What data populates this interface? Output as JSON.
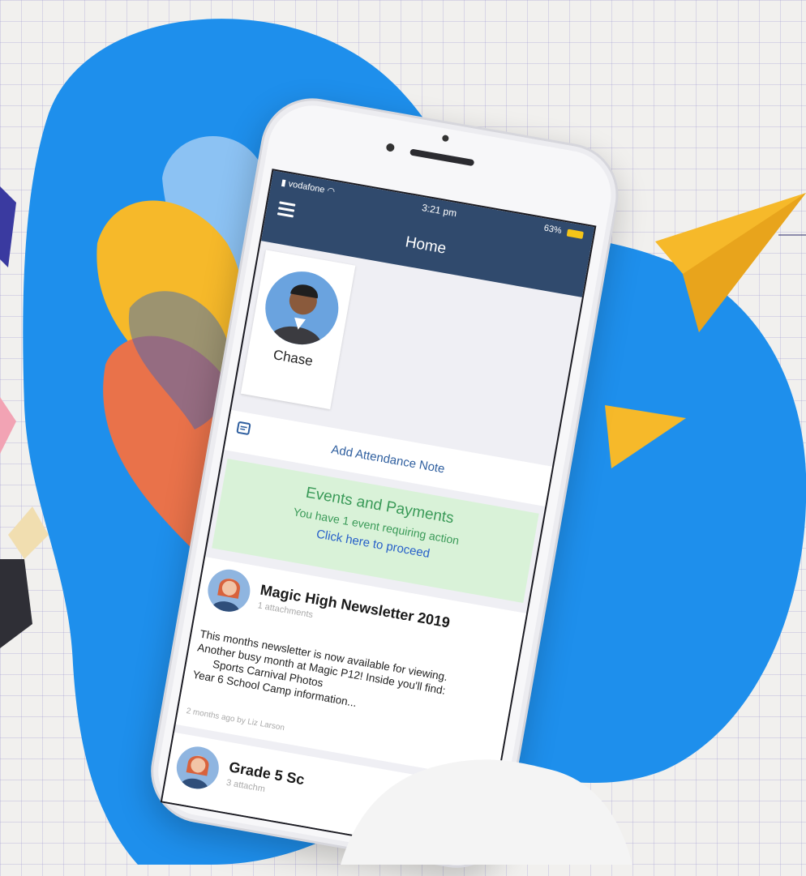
{
  "status_bar": {
    "carrier": "vodafone",
    "time": "3:21 pm",
    "battery": "63%"
  },
  "header": {
    "title": "Home"
  },
  "student": {
    "name": "Chase"
  },
  "attendance": {
    "label": "Add Attendance Note"
  },
  "events": {
    "title": "Events and Payments",
    "subtitle": "You have 1 event requiring action",
    "link": "Click here to proceed"
  },
  "feed": [
    {
      "title": "Magic High Newsletter 2019",
      "attachments": "1 attachments",
      "body_lines": [
        "This months newsletter is now available for viewing.",
        "Another busy month at Magic P12! Inside you'll find:",
        "Sports Carnival Photos",
        "Year 6 School Camp information..."
      ],
      "meta": "2 months ago by Liz Larson"
    },
    {
      "title": "Grade 5 Sc",
      "attachments": "3 attachm"
    }
  ],
  "colors": {
    "navbar": "#304a6d",
    "blob_blue": "#1e8fec",
    "accent_yellow": "#f6b92a",
    "accent_orange": "#e9724a",
    "events_bg": "#d9f2d8",
    "link_blue": "#2760c9"
  },
  "icons": [
    "menu-icon",
    "calendar-icon",
    "wifi-icon",
    "signal-icon",
    "battery-icon",
    "paper-plane-icon"
  ]
}
